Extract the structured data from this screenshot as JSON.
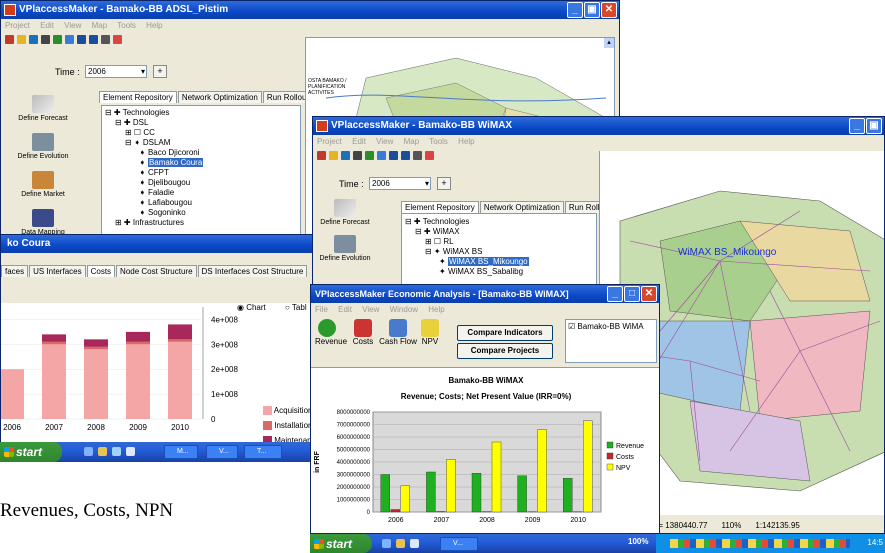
{
  "window1": {
    "title": "VPlaccessMaker - Bamako-BB ADSL_Pistim",
    "menu": [
      "Project",
      "Edit",
      "View",
      "Map",
      "Tools",
      "Help"
    ],
    "time_label": "Time :",
    "time_value": "2006",
    "tabs": [
      "Element Repository",
      "Network Optimization",
      "Run Rollout"
    ],
    "side_buttons": [
      "Define Forecast",
      "Define Evolution",
      "Define Market",
      "Data Mapping"
    ],
    "tree": [
      "Technologies",
      "DSL",
      "CC",
      "DSLAM",
      "Baco Djicoroni",
      "Bamako Coura",
      "CFPT",
      "Djelibougou",
      "Faladie",
      "Lafiabougou",
      "Sogoninko",
      "Infrastructures"
    ],
    "map_label": "OSTA BAMAKO / PLANIFICATION ACTIVITES"
  },
  "window2": {
    "title": "VPlaccessMaker - Bamako-BB WiMAX",
    "menu": [
      "Project",
      "Edit",
      "View",
      "Map",
      "Tools",
      "Help"
    ],
    "time_label": "Time :",
    "time_value": "2006",
    "tabs": [
      "Element Repository",
      "Network Optimization",
      "Run Rollout"
    ],
    "side_buttons": [
      "Define Forecast",
      "Define Evolution"
    ],
    "tree": [
      "Technologies",
      "WiMAX",
      "RL",
      "WiMAX BS",
      "WiMAX BS_Mikoungo",
      "WiMAX BS_Sabalibg"
    ],
    "map_label": "WiMAX BS_Mikoungo",
    "status": [
      "Y= 1380440.77",
      "110%",
      "1:142135.95"
    ]
  },
  "window3": {
    "title_partial": "ko Coura",
    "tabs": [
      "faces",
      "US Interfaces",
      "Costs",
      "Node Cost Structure",
      "DS Interfaces Cost Structure"
    ],
    "radio_chart": "Chart",
    "radio_table": "Tabl",
    "legend": [
      "Acquisition",
      "Installation",
      "Maintenan"
    ],
    "legend_colors": [
      "#f4a6a6",
      "#d96a6a",
      "#a8285c"
    ]
  },
  "econ_window": {
    "title": "VPlaccessMaker Economic Analysis - [Bamako-BB WiMAX]",
    "menu": [
      "File",
      "Edit",
      "View",
      "Window",
      "Help"
    ],
    "toolbar": [
      "Revenue",
      "Costs",
      "Cash Flow",
      "NPV"
    ],
    "compare_indicators": "Compare Indicators",
    "compare_projects": "Compare Projects",
    "project_checkbox": "Bamako-BB WiMA",
    "chart_title": "Bamako-BB WiMAX",
    "chart_subtitle": "Revenue; Costs; Net Present Value (IRR=0%)"
  },
  "taskbar1": {
    "start": "start",
    "items": [
      "M...",
      "V...",
      "T..."
    ]
  },
  "taskbar2": {
    "start": "start",
    "items": [
      "V..."
    ],
    "percent": "100%",
    "clock": "14:5"
  },
  "caption": "Revenues, Costs, NPN",
  "chart_data": [
    {
      "type": "bar",
      "title": "Bamako-BB WiMAX",
      "subtitle": "Revenue; Costs; Net Present Value (IRR=0%)",
      "ylabel": "in FRF",
      "categories": [
        "2006",
        "2007",
        "2008",
        "2009",
        "2010"
      ],
      "ylim": [
        0,
        8000000000
      ],
      "yticks": [
        "0",
        "1000000000",
        "2000000000",
        "3000000000",
        "4000000000",
        "5000000000",
        "6000000000",
        "7000000000",
        "8000000000"
      ],
      "series": [
        {
          "name": "Revenue",
          "color": "#1fb01f",
          "values": [
            3000000000,
            3200000000,
            3100000000,
            2900000000,
            2700000000
          ]
        },
        {
          "name": "Costs",
          "color": "#c0282a",
          "values": [
            200000000,
            40000000,
            30000000,
            20000000,
            20000000
          ]
        },
        {
          "name": "NPV",
          "color": "#ffff00",
          "values": [
            2100000000,
            4200000000,
            5600000000,
            6600000000,
            7300000000
          ]
        }
      ],
      "grid": true,
      "legend": "right"
    },
    {
      "type": "bar",
      "categories": [
        "2006",
        "2007",
        "2008",
        "2009",
        "2010"
      ],
      "yticks": [
        "0",
        "1e+008",
        "2e+008",
        "3e+008",
        "4e+008"
      ],
      "ylim": [
        0,
        450000000
      ],
      "series": [
        {
          "name": "Acquisition",
          "color": "#f4a6a6",
          "values": [
            200000000,
            300000000,
            280000000,
            300000000,
            310000000
          ]
        },
        {
          "name": "Installation",
          "color": "#d96a6a",
          "values": [
            0,
            10000000,
            10000000,
            10000000,
            10000000
          ]
        },
        {
          "name": "Maintenan",
          "color": "#a8285c",
          "values": [
            0,
            30000000,
            30000000,
            40000000,
            60000000
          ]
        }
      ],
      "legend": "right"
    }
  ]
}
